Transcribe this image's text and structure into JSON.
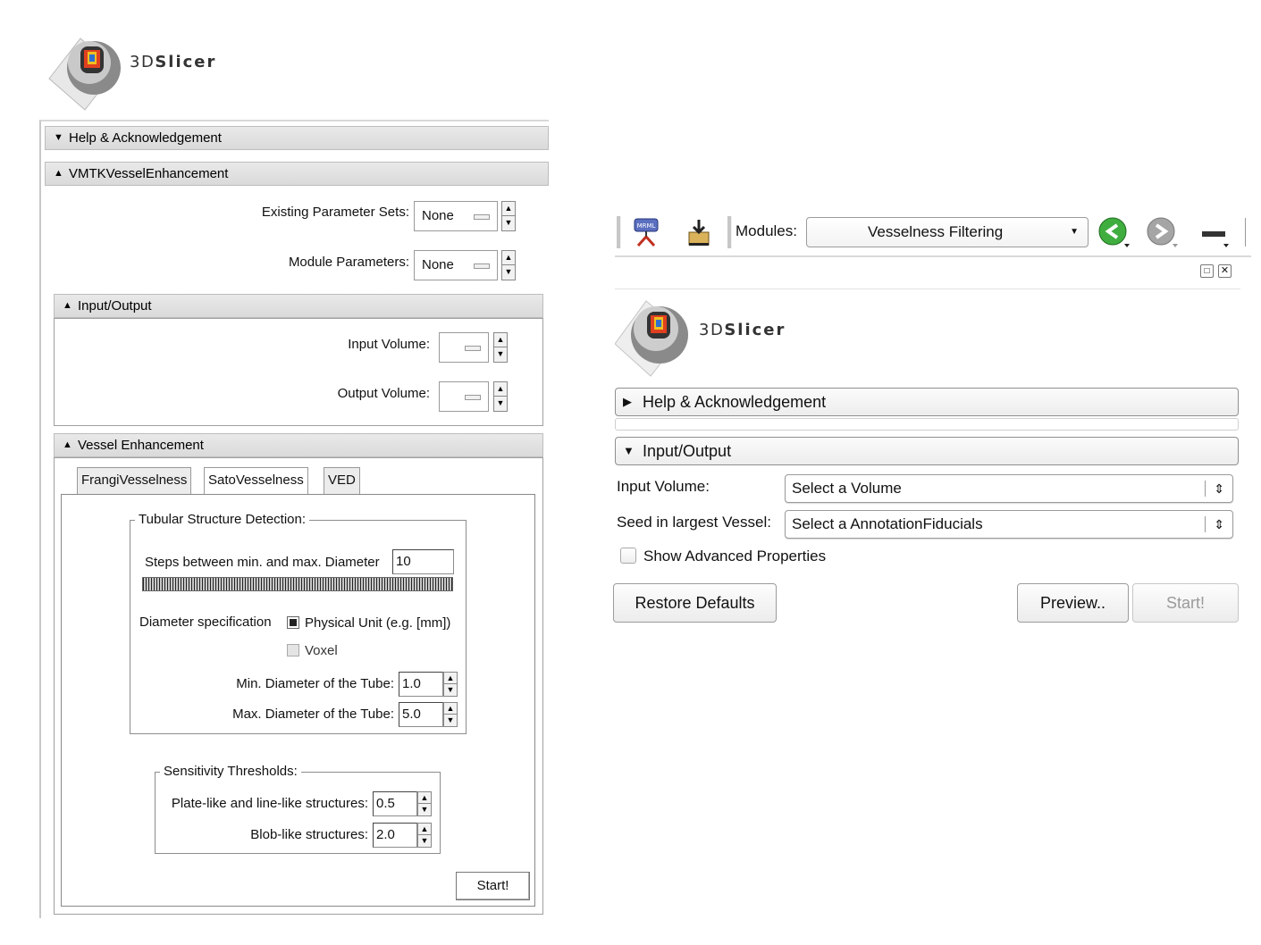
{
  "left_panel": {
    "logo": {
      "prefix": "3D",
      "name": "Slicer"
    },
    "sections": {
      "help": "Help & Acknowledgement",
      "module": "VMTKVesselEnhancement",
      "io": "Input/Output",
      "vessel": "Vessel Enhancement"
    },
    "params": {
      "existing_label": "Existing Parameter Sets:",
      "existing_value": "None",
      "module_label": "Module Parameters:",
      "module_value": "None"
    },
    "io": {
      "input_label": "Input Volume:",
      "output_label": "Output Volume:"
    },
    "tabs": [
      "FrangiVesselness",
      "SatoVesselness",
      "VED"
    ],
    "tubular": {
      "legend": "Tubular Structure Detection:",
      "steps_label": "Steps between min. and max. Diameter",
      "steps_value": "10",
      "diameter_spec_label": "Diameter specification",
      "option_physical": "Physical Unit (e.g. [mm])",
      "option_voxel": "Voxel",
      "min_label": "Min. Diameter of the Tube:",
      "min_value": "1.0",
      "max_label": "Max. Diameter of the Tube:",
      "max_value": "5.0"
    },
    "sensitivity": {
      "legend": "Sensitivity Thresholds:",
      "plate_label": "Plate-like and line-like structures:",
      "plate_value": "0.5",
      "blob_label": "Blob-like structures:",
      "blob_value": "2.0"
    },
    "start_label": "Start!"
  },
  "right_panel": {
    "toolbar": {
      "modules_label": "Modules:",
      "modules_value": "Vesselness Filtering",
      "icons": [
        "mrml-scene-icon",
        "load-data-icon",
        "back-icon",
        "forward-icon",
        "view-icon"
      ]
    },
    "logo": {
      "prefix": "3D",
      "name": "Slicer"
    },
    "sections": {
      "help": "Help & Acknowledgement",
      "io": "Input/Output"
    },
    "form": {
      "input_label": "Input Volume:",
      "input_value": "Select a Volume",
      "seed_label": "Seed in largest Vessel:",
      "seed_value": "Select a AnnotationFiducials",
      "advanced_label": "Show Advanced Properties"
    },
    "buttons": {
      "restore": "Restore Defaults",
      "preview": "Preview..",
      "start": "Start!"
    }
  },
  "colors": {
    "section_bg": "#dadada",
    "nav_green": "#3fae3f",
    "disabled_text": "#9a9a9a"
  }
}
